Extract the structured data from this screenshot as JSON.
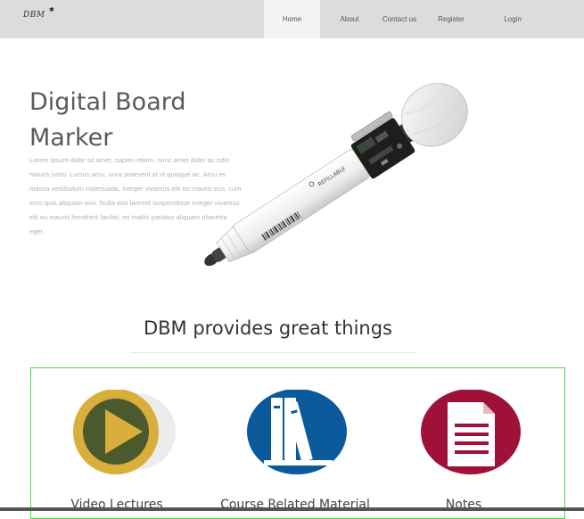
{
  "brand": {
    "logo_text": "DBM",
    "logo_mark": "✱"
  },
  "nav": {
    "items": [
      {
        "label": "Home",
        "active": true
      },
      {
        "label": "About"
      },
      {
        "label": "Contact us"
      },
      {
        "label": "Register"
      },
      {
        "label": "Login"
      }
    ]
  },
  "hero": {
    "title_line1": "Digital Board",
    "title_line2": "Marker",
    "body": "Lorem ipsum dolor sit amet, sapien etiam, nunc amet dolor ac odio mauris justo. Luctus arcu, urna praesent at id quisque ac. Arcu es massa vestibulum malesuada, integer vivamus elit eu mauris eus, cum eros quis aliquam wisi. Nulla wisi laoreet suspendisse integer vivamus elit eu mauris hendrerit facilisi, mi mattis pariatur aliquam pharetra eget.",
    "marker_label": "REFILLABLE"
  },
  "section": {
    "title": "DBM provides great things"
  },
  "features": [
    {
      "label": "Video Lectures",
      "icon": "play-icon",
      "color": "#d9ae3a",
      "inner": "#4a5a2c"
    },
    {
      "label": "Course Related Material",
      "icon": "books-icon",
      "color": "#0b5a9c"
    },
    {
      "label": "Notes",
      "icon": "document-icon",
      "color": "#a0113a"
    }
  ],
  "colors": {
    "navbar": "#dcdcdc",
    "accent_border": "#4fd64f"
  }
}
